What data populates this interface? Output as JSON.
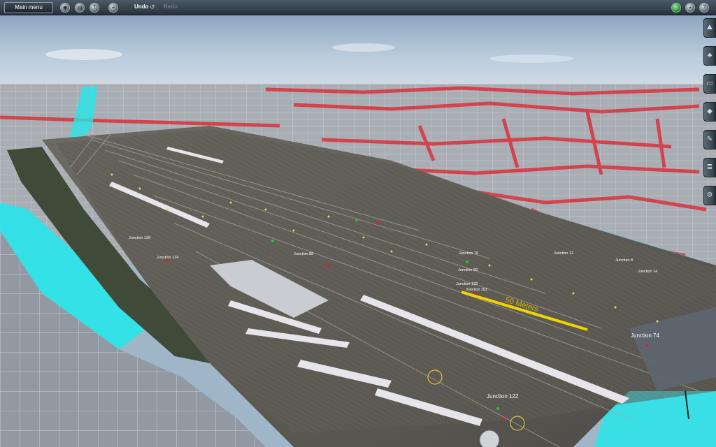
{
  "toolbar": {
    "main_menu_label": "Main menu",
    "undo_label": "Undo",
    "redo_label": "Redo",
    "left_buttons": [
      "camera-icon",
      "trash-icon",
      "paint-icon",
      "layers-icon"
    ],
    "right_buttons": [
      "status-green-icon",
      "add-icon",
      "help-icon"
    ]
  },
  "sidebar": {
    "tabs": [
      "terrain-tool-icon",
      "objects-tool-icon",
      "track-tool-icon",
      "trackside-tool-icon",
      "tools-icon",
      "layers-tab-icon",
      "settings-icon"
    ]
  },
  "viewport": {
    "measure_label": "50 Meters",
    "junctions": [
      "Junction 120",
      "Junction 124",
      "Junction 88",
      "Junction 76",
      "Junction 12",
      "Junction 8",
      "Junction 14",
      "Junction 98",
      "Junction 132",
      "Junction 102",
      "Junction 74",
      "Junction 122"
    ]
  },
  "colors": {
    "accent_cyan": "#27e6ea",
    "height_red": "#e0202c",
    "measure_yellow": "#f2d400",
    "toolbar_bg": "#2e3a44"
  }
}
